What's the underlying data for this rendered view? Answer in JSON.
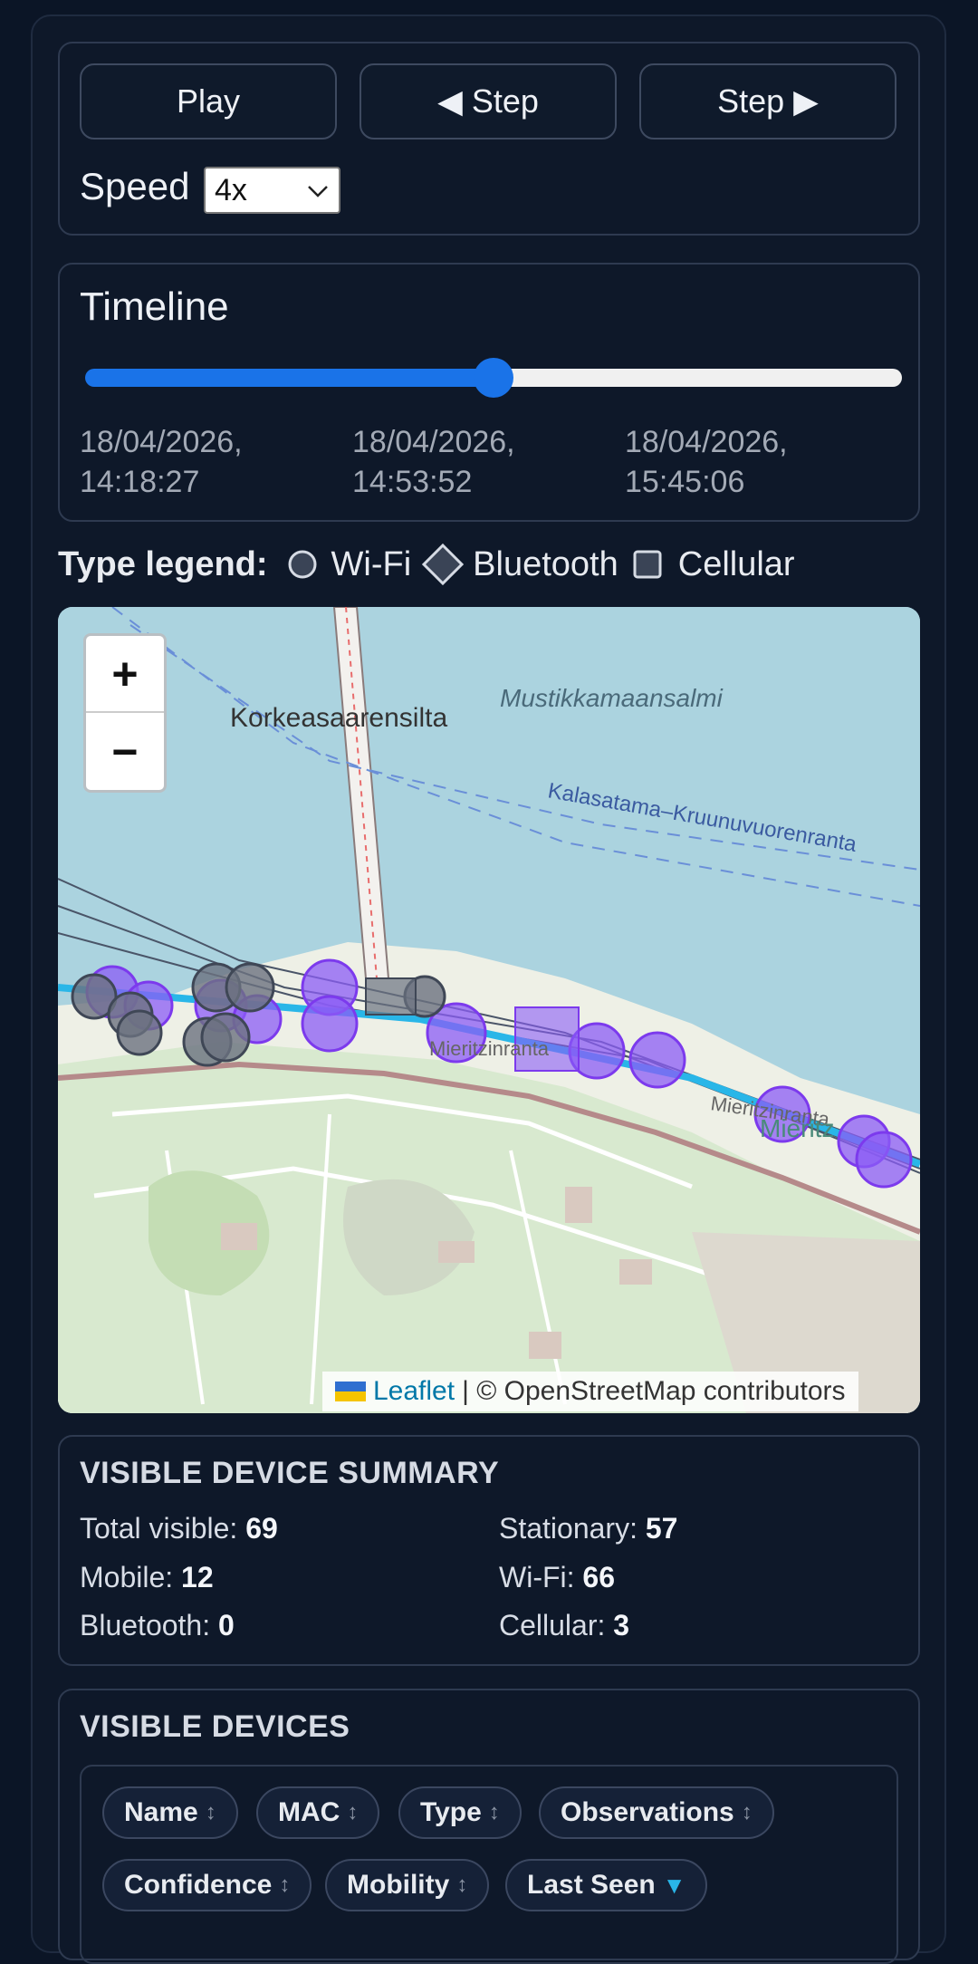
{
  "controls": {
    "play_label": "Play",
    "step_back_label": "◀ Step",
    "step_fwd_label": "Step ▶",
    "speed_label": "Speed",
    "speed_value": "4x"
  },
  "timeline": {
    "title": "Timeline",
    "position_fraction": 0.5,
    "start": "18/04/2026, 14:18:27",
    "current": "18/04/2026, 14:53:52",
    "end": "18/04/2026, 15:45:06"
  },
  "legend": {
    "title": "Type legend:",
    "items": [
      {
        "label": "Wi-Fi",
        "icon": "circle-icon"
      },
      {
        "label": "Bluetooth",
        "icon": "diamond-icon"
      },
      {
        "label": "Cellular",
        "icon": "square-icon"
      }
    ]
  },
  "map": {
    "labels": {
      "bridge": "Korkeasaarensilta",
      "strait": "Mustikkamaansalmi",
      "route": "Kalasatama–Kruunuvuorenranta",
      "road1": "Mieritzinranta",
      "road2": "Mieritzinranta",
      "road3": "Mieritz"
    },
    "zoom_in": "+",
    "zoom_out": "−",
    "attribution_link": "Leaflet",
    "attribution_text": "| © OpenStreetMap contributors",
    "colors": {
      "water": "#abd3df",
      "marker_purple": "#8b5cf6",
      "marker_gray": "#6b7280"
    }
  },
  "summary": {
    "title": "VISIBLE DEVICE SUMMARY",
    "total_label": "Total visible:",
    "total": "69",
    "stationary_label": "Stationary:",
    "stationary": "57",
    "mobile_label": "Mobile:",
    "mobile": "12",
    "wifi_label": "Wi-Fi:",
    "wifi": "66",
    "bluetooth_label": "Bluetooth:",
    "bluetooth": "0",
    "cellular_label": "Cellular:",
    "cellular": "3"
  },
  "devices": {
    "title": "VISIBLE DEVICES",
    "columns": [
      "Name",
      "MAC",
      "Type",
      "Observations",
      "Confidence",
      "Mobility",
      "Last Seen"
    ],
    "sort_icon": "↕",
    "active_sort_icon": "▼"
  }
}
